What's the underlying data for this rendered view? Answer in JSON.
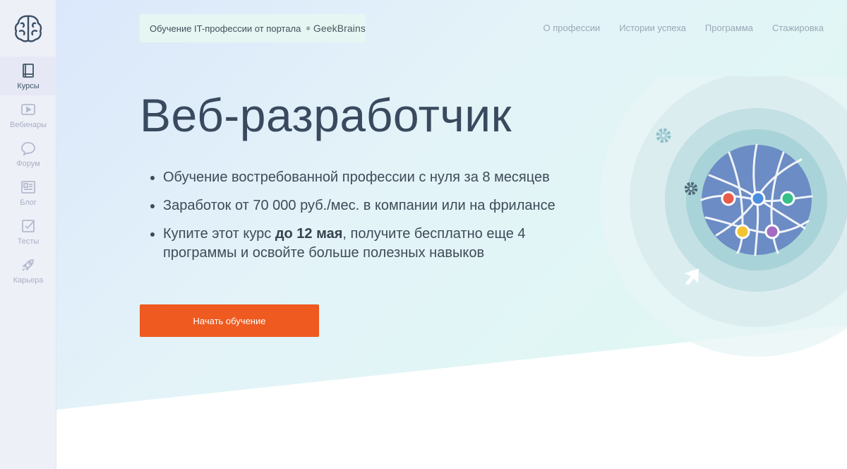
{
  "sidebar": {
    "items": [
      {
        "label": "Курсы",
        "icon": "book-icon",
        "active": true
      },
      {
        "label": "Вебинары",
        "icon": "video-icon",
        "active": false
      },
      {
        "label": "Форум",
        "icon": "chat-icon",
        "active": false
      },
      {
        "label": "Блог",
        "icon": "newspaper-icon",
        "active": false
      },
      {
        "label": "Тесты",
        "icon": "checkbox-icon",
        "active": false
      },
      {
        "label": "Карьера",
        "icon": "rocket-icon",
        "active": false
      }
    ]
  },
  "header": {
    "portal_text": "Обучение IT-профессии от портала",
    "brand": "GeekBrains",
    "nav": [
      "О профессии",
      "Истории успеха",
      "Программа",
      "Стажировка"
    ]
  },
  "hero": {
    "title": "Веб-разработчик",
    "bullet1": "Обучение востребованной профессии с нуля за 8 месяцев",
    "bullet2": "Заработок от 70 000 руб./мес. в компании или на фрилансе",
    "bullet3_pre": "Купите этот курс ",
    "bullet3_bold": "до 12 мая",
    "bullet3_post": ", получите бесплатно еще 4 программы и освойте больше полезных навыков",
    "cta": "Начать обучение"
  },
  "colors": {
    "accent": "#ee5a1f",
    "globe": "#6b8cc4",
    "node_colors": [
      "#e85c4a",
      "#4a8fe0",
      "#36c08a",
      "#f2c531",
      "#a36cc1"
    ]
  }
}
